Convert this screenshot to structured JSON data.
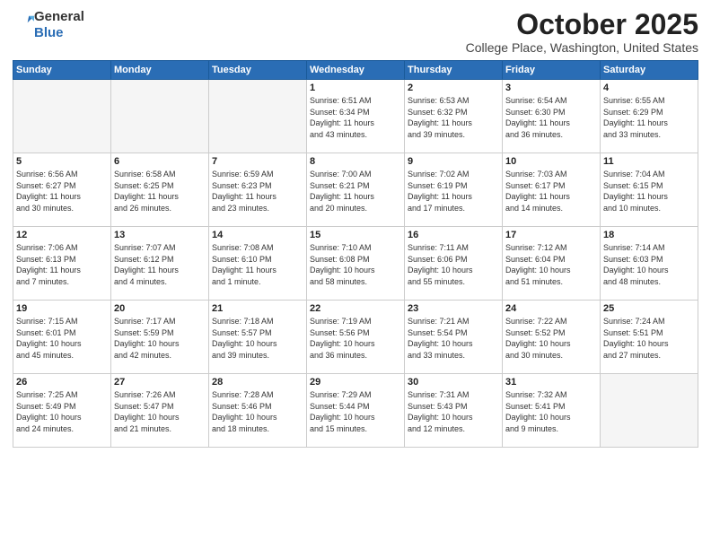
{
  "logo": {
    "general": "General",
    "blue": "Blue"
  },
  "title": "October 2025",
  "subtitle": "College Place, Washington, United States",
  "days_of_week": [
    "Sunday",
    "Monday",
    "Tuesday",
    "Wednesday",
    "Thursday",
    "Friday",
    "Saturday"
  ],
  "weeks": [
    [
      {
        "day": "",
        "info": ""
      },
      {
        "day": "",
        "info": ""
      },
      {
        "day": "",
        "info": ""
      },
      {
        "day": "1",
        "info": "Sunrise: 6:51 AM\nSunset: 6:34 PM\nDaylight: 11 hours\nand 43 minutes."
      },
      {
        "day": "2",
        "info": "Sunrise: 6:53 AM\nSunset: 6:32 PM\nDaylight: 11 hours\nand 39 minutes."
      },
      {
        "day": "3",
        "info": "Sunrise: 6:54 AM\nSunset: 6:30 PM\nDaylight: 11 hours\nand 36 minutes."
      },
      {
        "day": "4",
        "info": "Sunrise: 6:55 AM\nSunset: 6:29 PM\nDaylight: 11 hours\nand 33 minutes."
      }
    ],
    [
      {
        "day": "5",
        "info": "Sunrise: 6:56 AM\nSunset: 6:27 PM\nDaylight: 11 hours\nand 30 minutes."
      },
      {
        "day": "6",
        "info": "Sunrise: 6:58 AM\nSunset: 6:25 PM\nDaylight: 11 hours\nand 26 minutes."
      },
      {
        "day": "7",
        "info": "Sunrise: 6:59 AM\nSunset: 6:23 PM\nDaylight: 11 hours\nand 23 minutes."
      },
      {
        "day": "8",
        "info": "Sunrise: 7:00 AM\nSunset: 6:21 PM\nDaylight: 11 hours\nand 20 minutes."
      },
      {
        "day": "9",
        "info": "Sunrise: 7:02 AM\nSunset: 6:19 PM\nDaylight: 11 hours\nand 17 minutes."
      },
      {
        "day": "10",
        "info": "Sunrise: 7:03 AM\nSunset: 6:17 PM\nDaylight: 11 hours\nand 14 minutes."
      },
      {
        "day": "11",
        "info": "Sunrise: 7:04 AM\nSunset: 6:15 PM\nDaylight: 11 hours\nand 10 minutes."
      }
    ],
    [
      {
        "day": "12",
        "info": "Sunrise: 7:06 AM\nSunset: 6:13 PM\nDaylight: 11 hours\nand 7 minutes."
      },
      {
        "day": "13",
        "info": "Sunrise: 7:07 AM\nSunset: 6:12 PM\nDaylight: 11 hours\nand 4 minutes."
      },
      {
        "day": "14",
        "info": "Sunrise: 7:08 AM\nSunset: 6:10 PM\nDaylight: 11 hours\nand 1 minute."
      },
      {
        "day": "15",
        "info": "Sunrise: 7:10 AM\nSunset: 6:08 PM\nDaylight: 10 hours\nand 58 minutes."
      },
      {
        "day": "16",
        "info": "Sunrise: 7:11 AM\nSunset: 6:06 PM\nDaylight: 10 hours\nand 55 minutes."
      },
      {
        "day": "17",
        "info": "Sunrise: 7:12 AM\nSunset: 6:04 PM\nDaylight: 10 hours\nand 51 minutes."
      },
      {
        "day": "18",
        "info": "Sunrise: 7:14 AM\nSunset: 6:03 PM\nDaylight: 10 hours\nand 48 minutes."
      }
    ],
    [
      {
        "day": "19",
        "info": "Sunrise: 7:15 AM\nSunset: 6:01 PM\nDaylight: 10 hours\nand 45 minutes."
      },
      {
        "day": "20",
        "info": "Sunrise: 7:17 AM\nSunset: 5:59 PM\nDaylight: 10 hours\nand 42 minutes."
      },
      {
        "day": "21",
        "info": "Sunrise: 7:18 AM\nSunset: 5:57 PM\nDaylight: 10 hours\nand 39 minutes."
      },
      {
        "day": "22",
        "info": "Sunrise: 7:19 AM\nSunset: 5:56 PM\nDaylight: 10 hours\nand 36 minutes."
      },
      {
        "day": "23",
        "info": "Sunrise: 7:21 AM\nSunset: 5:54 PM\nDaylight: 10 hours\nand 33 minutes."
      },
      {
        "day": "24",
        "info": "Sunrise: 7:22 AM\nSunset: 5:52 PM\nDaylight: 10 hours\nand 30 minutes."
      },
      {
        "day": "25",
        "info": "Sunrise: 7:24 AM\nSunset: 5:51 PM\nDaylight: 10 hours\nand 27 minutes."
      }
    ],
    [
      {
        "day": "26",
        "info": "Sunrise: 7:25 AM\nSunset: 5:49 PM\nDaylight: 10 hours\nand 24 minutes."
      },
      {
        "day": "27",
        "info": "Sunrise: 7:26 AM\nSunset: 5:47 PM\nDaylight: 10 hours\nand 21 minutes."
      },
      {
        "day": "28",
        "info": "Sunrise: 7:28 AM\nSunset: 5:46 PM\nDaylight: 10 hours\nand 18 minutes."
      },
      {
        "day": "29",
        "info": "Sunrise: 7:29 AM\nSunset: 5:44 PM\nDaylight: 10 hours\nand 15 minutes."
      },
      {
        "day": "30",
        "info": "Sunrise: 7:31 AM\nSunset: 5:43 PM\nDaylight: 10 hours\nand 12 minutes."
      },
      {
        "day": "31",
        "info": "Sunrise: 7:32 AM\nSunset: 5:41 PM\nDaylight: 10 hours\nand 9 minutes."
      },
      {
        "day": "",
        "info": ""
      }
    ]
  ]
}
